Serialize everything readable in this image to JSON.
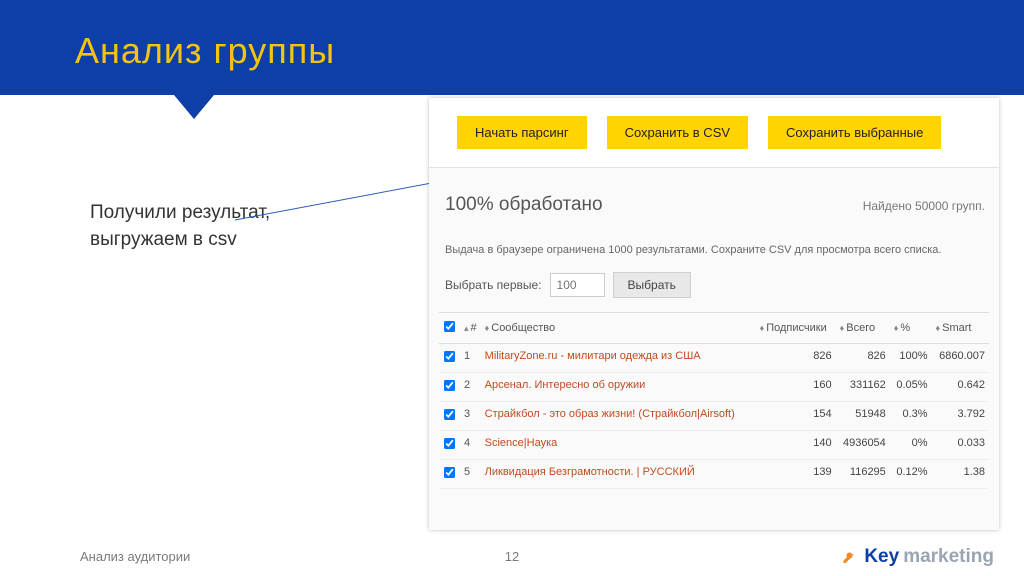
{
  "slide": {
    "title": "Анализ группы",
    "note": "Получили результат, выгружаем в csv",
    "footer_text": "Анализ аудитории",
    "page_num": "12",
    "logo_key": "Key",
    "logo_rest": "marketing"
  },
  "buttons": {
    "parse": "Начать парсинг",
    "csv": "Сохранить в CSV",
    "save_sel": "Сохранить выбранные",
    "choose": "Выбрать"
  },
  "status": {
    "processed": "100% обработано",
    "found": "Найдено 50000 групп."
  },
  "hint": "Выдача в браузере ограничена 1000 результатами. Сохраните CSV для просмотра всего списка.",
  "select_row": {
    "label": "Выбрать первые:",
    "placeholder": "100"
  },
  "cols": {
    "idx": "#",
    "community": "Сообщество",
    "subs": "Подписчики",
    "total": "Всего",
    "pct": "%",
    "smart": "Smart"
  },
  "rows": [
    {
      "idx": "1",
      "name": "MilitaryZone.ru - милитари одежда из США",
      "subs": "826",
      "total": "826",
      "pct": "100%",
      "smart": "6860.007"
    },
    {
      "idx": "2",
      "name": "Арсенал. Интересно об оружии",
      "subs": "160",
      "total": "331162",
      "pct": "0.05%",
      "smart": "0.642"
    },
    {
      "idx": "3",
      "name": "Страйкбол - это образ жизни! (Страйкбол|Airsoft)",
      "subs": "154",
      "total": "51948",
      "pct": "0.3%",
      "smart": "3.792"
    },
    {
      "idx": "4",
      "name": "Science|Наука",
      "subs": "140",
      "total": "4936054",
      "pct": "0%",
      "smart": "0.033"
    },
    {
      "idx": "5",
      "name": "Ликвидация Безграмотности. | РУССКИЙ",
      "subs": "139",
      "total": "116295",
      "pct": "0.12%",
      "smart": "1.38"
    }
  ]
}
